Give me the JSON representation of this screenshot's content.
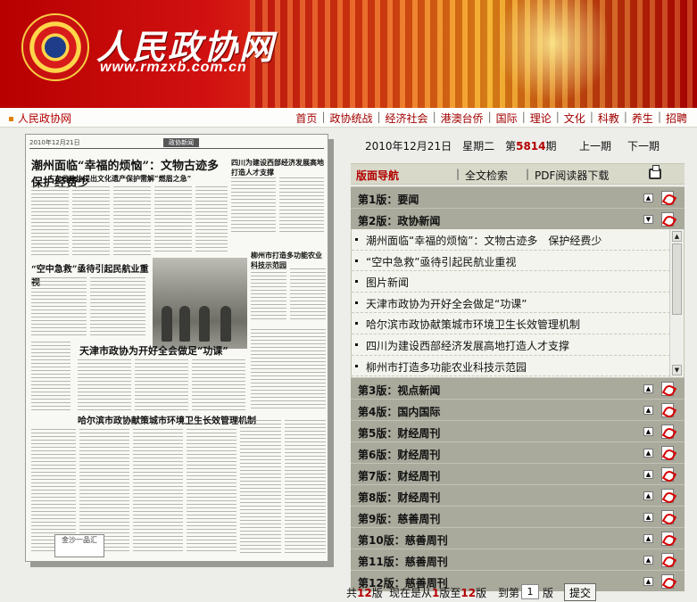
{
  "banner": {
    "logo_text": "人民政协网",
    "logo_url": "www.rmzxb.com.cn",
    "emblem_icon": "cppcc-emblem-icon"
  },
  "nav": {
    "home": "人民政协网",
    "items": [
      "首页",
      "政协统战",
      "经济社会",
      "港澳台侨",
      "国际",
      "理论",
      "文化",
      "科教",
      "养生",
      "招聘"
    ]
  },
  "paper": {
    "headline_main": "潮州面临“幸福的烦恼”：文物古迹多 保护经费少",
    "headline_sub": "广东省政协提出文化遗产保护需解“燃眉之急”",
    "headline_2": "“空中急救”亟待引起民航业重视",
    "headline_3": "天津市政协为开好全会做足“功课”",
    "headline_4": "哈尔滨市政协献策城市环境卫生长效管理机制",
    "headline_5": "四川为建设西部经济发展高地打造人才支撑",
    "headline_6": "柳州市打造多功能农业科技示范园",
    "section": "政协新闻",
    "date_line": "2010年12月21日",
    "ad_text": "金沙一品汇"
  },
  "info": {
    "date_prefix": "2010年12月21日　星期二　第",
    "issue_no": "5814",
    "issue_suffix": "期",
    "prev": "上一期",
    "next": "下一期"
  },
  "toolbar": {
    "nav_label": "版面导航",
    "fulltext": "全文检索",
    "pdf_download": "PDF阅读器下载",
    "print_icon": "printer-icon"
  },
  "editions": [
    {
      "label": "第1版：要闻",
      "toggle": "▲"
    },
    {
      "label": "第2版：政协新闻",
      "toggle": "▼"
    }
  ],
  "articles": [
    "潮州面临“幸福的烦恼”：文物古迹多　保护经费少",
    "“空中急救”亟待引起民航业重视",
    "图片新闻",
    "天津市政协为开好全会做足“功课”",
    "哈尔滨市政协献策城市环境卫生长效管理机制",
    "四川为建设西部经济发展高地打造人才支撑",
    "柳州市打造多功能农业科技示范园"
  ],
  "editions_after": [
    {
      "label": "第3版：视点新闻"
    },
    {
      "label": "第4版：国内国际"
    },
    {
      "label": "第5版：财经周刊"
    },
    {
      "label": "第6版：财经周刊"
    },
    {
      "label": "第7版：财经周刊"
    },
    {
      "label": "第8版：财经周刊"
    },
    {
      "label": "第9版：慈善周刊"
    },
    {
      "label": "第10版：慈善周刊"
    },
    {
      "label": "第11版：慈善周刊"
    },
    {
      "label": "第12版：慈善周刊"
    }
  ],
  "pager": {
    "total_prefix": "共",
    "total": "12",
    "total_suffix": "版",
    "range_prefix": "现在是从",
    "range_from": "1",
    "range_mid": "版至",
    "range_to": "12",
    "range_suffix": "版",
    "goto_prefix": "到第",
    "goto_value": "1",
    "goto_suffix": "版",
    "submit": "提交"
  },
  "colors": {
    "accent": "#b30000",
    "row_bg": "#a9a99c",
    "toolbar_bg": "#d9d9ca"
  }
}
